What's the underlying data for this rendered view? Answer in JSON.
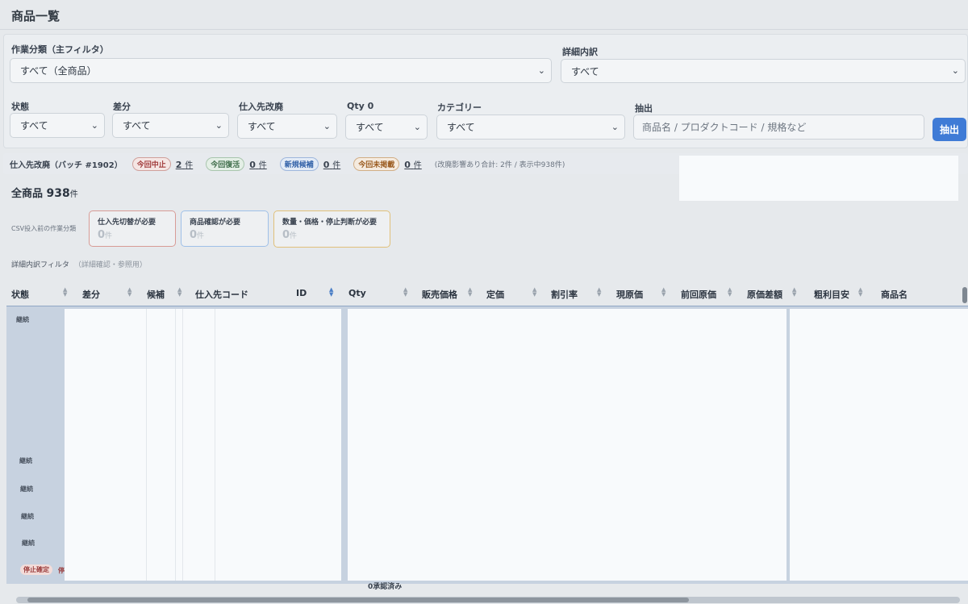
{
  "page": {
    "title": "商品一覧"
  },
  "filters": {
    "work_category": {
      "label": "作業分類（主フィルタ）",
      "value": "すべて（全商品）"
    },
    "detail_breakdown": {
      "label": "詳細内訳",
      "value": "すべて"
    },
    "status": {
      "label": "状態",
      "value": "すべて"
    },
    "diff": {
      "label": "差分",
      "value": "すべて"
    },
    "supplier_revision": {
      "label": "仕入先改廃",
      "value": "すべて"
    },
    "qty0": {
      "label": "Qty 0",
      "value": "すべて"
    },
    "category": {
      "label": "カテゴリー",
      "value": "すべて"
    },
    "extract": {
      "label": "抽出",
      "placeholder": "商品名 / プロダクトコード / 規格など",
      "button": "抽出"
    }
  },
  "batch": {
    "label": "仕入先改廃（バッチ #1902）",
    "pills": [
      {
        "label": "今回中止",
        "count": "2",
        "unit": "件",
        "color": "#a23c3c"
      },
      {
        "label": "今回復活",
        "count": "0",
        "unit": "件",
        "color": "#3c6b47"
      },
      {
        "label": "新規候補",
        "count": "0",
        "unit": "件",
        "color": "#2d5ea6"
      },
      {
        "label": "今回未掲載",
        "count": "0",
        "unit": "件",
        "color": "#9a5a1e"
      }
    ],
    "note": "(改廃影響あり合計: 2件 / 表示中938件)"
  },
  "summary": {
    "label": "全商品",
    "count": "938",
    "unit": "件"
  },
  "csv_cards": {
    "label": "CSV投入前の作業分類",
    "cards": [
      {
        "title": "仕入先切替が必要",
        "count": "0",
        "unit": "件",
        "color": "#d89c96"
      },
      {
        "title": "商品確認が必要",
        "count": "0",
        "unit": "件",
        "color": "#9fc0e8"
      },
      {
        "title": "数量・価格・停止判断が必要",
        "count": "0",
        "unit": "件",
        "color": "#e0c07a"
      }
    ]
  },
  "detail_filter": {
    "label": "詳細内訳フィルタ",
    "sub": "（詳細確認・参照用）"
  },
  "table": {
    "columns": [
      "状態",
      "差分",
      "候補",
      "仕入先コード",
      "ID",
      "Qty",
      "販売価格",
      "定価",
      "割引率",
      "現原価",
      "前回原価",
      "原価差額",
      "粗利目安",
      "商品名"
    ],
    "rows": [
      {
        "status": "継続"
      },
      {
        "status": "継続"
      },
      {
        "status": "継続"
      },
      {
        "status": "継続"
      },
      {
        "status": "継続"
      },
      {
        "status": "停止確定",
        "extra": "停"
      }
    ]
  },
  "footer": {
    "text": "0承認済み"
  },
  "colors": {
    "accent": "#3f7bd6",
    "background": "#e6e9ec"
  },
  "icons": [
    "chevron-down-icon",
    "sort-icon"
  ]
}
